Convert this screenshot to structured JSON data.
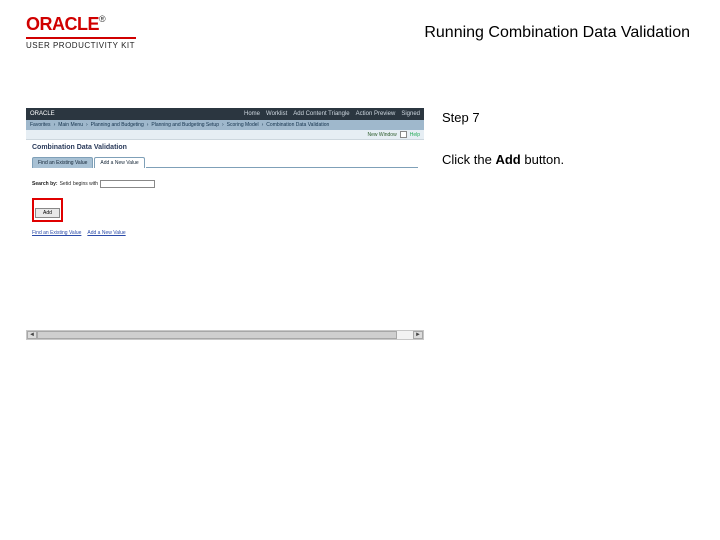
{
  "brand": {
    "name": "ORACLE",
    "tm": "®",
    "subtitle": "USER PRODUCTIVITY KIT"
  },
  "doc_title": "Running Combination Data Validation",
  "instruction": {
    "step_label": "Step 7",
    "text_prefix": "Click the ",
    "bold_word": "Add",
    "text_suffix": " button."
  },
  "app": {
    "logo": "ORACLE",
    "tabs": [
      "Home",
      "Worklist",
      "Add Content Triangle",
      "Action Preview",
      "Signed"
    ],
    "breadcrumb": [
      "Favorites",
      "Main Menu",
      "Planning and Budgeting",
      "Planning and Budgeting Setup",
      "Scoring Model",
      "Combination Data Validation"
    ],
    "toolbar": {
      "new_window": "New Window",
      "help": "Help"
    },
    "page_title": "Combination Data Validation",
    "inner_tabs": {
      "tab1": "Find an Existing Value",
      "tab2": "Add a New Value"
    },
    "find": {
      "label": "Search by:",
      "field_label": "Setid",
      "op": "begins with",
      "value": ""
    },
    "add_label": "Add",
    "links": {
      "l1": "Find an Existing Value",
      "l2": "Add a New Value"
    }
  }
}
